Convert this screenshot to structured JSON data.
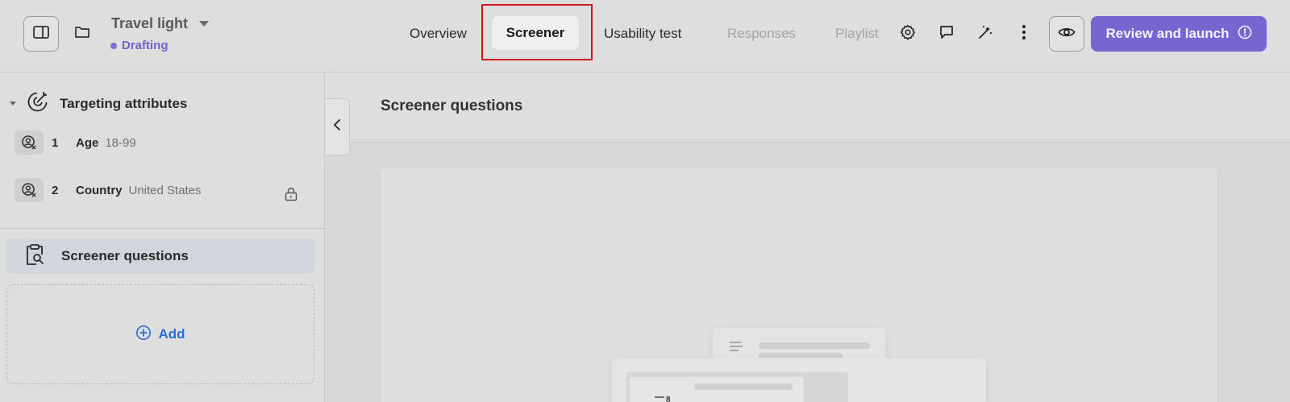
{
  "project": {
    "title": "Travel light",
    "status": "Drafting"
  },
  "nav": {
    "tabs": [
      {
        "label": "Overview"
      },
      {
        "label": "Screener"
      },
      {
        "label": "Usability test"
      },
      {
        "label": "Responses"
      },
      {
        "label": "Playlist"
      }
    ],
    "active_tab": "Screener"
  },
  "toolbar": {
    "icons": [
      "settings-icon",
      "comment-icon",
      "magic-wand-icon",
      "more-vertical-icon"
    ],
    "preview_icon": "eye-icon",
    "launch_label": "Review and launch",
    "launch_icon": "alert-circle-icon"
  },
  "sidebar": {
    "targeting": {
      "title": "Targeting attributes",
      "items": [
        {
          "number": "1",
          "name": "Age",
          "value": "18-99"
        },
        {
          "number": "2",
          "name": "Country",
          "value": "United States"
        }
      ]
    },
    "screener": {
      "label": "Screener questions"
    },
    "add_label": "Add"
  },
  "main": {
    "title": "Screener questions"
  },
  "colors": {
    "accent": "#7566d0",
    "status": "#6f63c7",
    "link": "#2a6fd0",
    "highlight": "#d0161c"
  }
}
